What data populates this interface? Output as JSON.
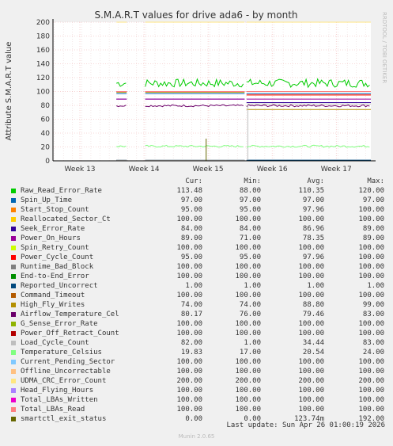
{
  "chart_data": {
    "type": "line",
    "title": "S.M.A.R.T values for drive ada6 - by month",
    "ylabel": "Attribute S.M.A.R.T value",
    "ylim": [
      0,
      200
    ],
    "yticks": [
      0,
      20,
      40,
      60,
      80,
      100,
      120,
      140,
      160,
      180,
      200
    ],
    "xticks": [
      "Week 13",
      "Week 14",
      "Week 15",
      "Week 16",
      "Week 17"
    ],
    "side_label": "RRDTOOL / TOBI OETIKER",
    "grid": true,
    "columns": [
      "Cur:",
      "Min:",
      "Avg:",
      "Max:"
    ],
    "series": [
      {
        "name": "Raw_Read_Error_Rate",
        "color": "#00cc00",
        "cur": "113.48",
        "min": "88.00",
        "avg": "110.35",
        "max": "120.00"
      },
      {
        "name": "Spin_Up_Time",
        "color": "#0066b3",
        "cur": "97.00",
        "min": "97.00",
        "avg": "97.00",
        "max": "97.00"
      },
      {
        "name": "Start_Stop_Count",
        "color": "#ff8000",
        "cur": "95.00",
        "min": "95.00",
        "avg": "97.96",
        "max": "100.00"
      },
      {
        "name": "Reallocated_Sector_Ct",
        "color": "#ffcc00",
        "cur": "100.00",
        "min": "100.00",
        "avg": "100.00",
        "max": "100.00"
      },
      {
        "name": "Seek_Error_Rate",
        "color": "#330099",
        "cur": "84.00",
        "min": "84.00",
        "avg": "86.96",
        "max": "89.00"
      },
      {
        "name": "Power_On_Hours",
        "color": "#990099",
        "cur": "89.00",
        "min": "71.00",
        "avg": "78.35",
        "max": "89.00"
      },
      {
        "name": "Spin_Retry_Count",
        "color": "#ccff00",
        "cur": "100.00",
        "min": "100.00",
        "avg": "100.00",
        "max": "100.00"
      },
      {
        "name": "Power_Cycle_Count",
        "color": "#ff0000",
        "cur": "95.00",
        "min": "95.00",
        "avg": "97.96",
        "max": "100.00"
      },
      {
        "name": "Runtime_Bad_Block",
        "color": "#808080",
        "cur": "100.00",
        "min": "100.00",
        "avg": "100.00",
        "max": "100.00"
      },
      {
        "name": "End-to-End_Error",
        "color": "#008f00",
        "cur": "100.00",
        "min": "100.00",
        "avg": "100.00",
        "max": "100.00"
      },
      {
        "name": "Reported_Uncorrect",
        "color": "#00487d",
        "cur": "1.00",
        "min": "1.00",
        "avg": "1.00",
        "max": "1.00"
      },
      {
        "name": "Command_Timeout",
        "color": "#b35a00",
        "cur": "100.00",
        "min": "100.00",
        "avg": "100.00",
        "max": "100.00"
      },
      {
        "name": "High_Fly_Writes",
        "color": "#b38f00",
        "cur": "74.00",
        "min": "74.00",
        "avg": "88.80",
        "max": "99.00"
      },
      {
        "name": "Airflow_Temperature_Cel",
        "color": "#6b006b",
        "cur": "80.17",
        "min": "76.00",
        "avg": "79.46",
        "max": "83.00"
      },
      {
        "name": "G_Sense_Error_Rate",
        "color": "#8fb300",
        "cur": "100.00",
        "min": "100.00",
        "avg": "100.00",
        "max": "100.00"
      },
      {
        "name": "Power_Off_Retract_Count",
        "color": "#b30000",
        "cur": "100.00",
        "min": "100.00",
        "avg": "100.00",
        "max": "100.00"
      },
      {
        "name": "Load_Cycle_Count",
        "color": "#bebebe",
        "cur": "82.00",
        "min": "1.00",
        "avg": "34.44",
        "max": "83.00"
      },
      {
        "name": "Temperature_Celsius",
        "color": "#80ff80",
        "cur": "19.83",
        "min": "17.00",
        "avg": "20.54",
        "max": "24.00"
      },
      {
        "name": "Current_Pending_Sector",
        "color": "#80c9ff",
        "cur": "100.00",
        "min": "100.00",
        "avg": "100.00",
        "max": "100.00"
      },
      {
        "name": "Offline_Uncorrectable",
        "color": "#ffc080",
        "cur": "100.00",
        "min": "100.00",
        "avg": "100.00",
        "max": "100.00"
      },
      {
        "name": "UDMA_CRC_Error_Count",
        "color": "#ffe680",
        "cur": "200.00",
        "min": "200.00",
        "avg": "200.00",
        "max": "200.00"
      },
      {
        "name": "Head_Flying_Hours",
        "color": "#aa80ff",
        "cur": "100.00",
        "min": "100.00",
        "avg": "100.00",
        "max": "100.00"
      },
      {
        "name": "Total_LBAs_Written",
        "color": "#ee00cc",
        "cur": "100.00",
        "min": "100.00",
        "avg": "100.00",
        "max": "100.00"
      },
      {
        "name": "Total_LBAs_Read",
        "color": "#ff8080",
        "cur": "100.00",
        "min": "100.00",
        "avg": "100.00",
        "max": "100.00"
      },
      {
        "name": "smartctl_exit_status",
        "color": "#666600",
        "cur": "0.00",
        "min": "0.00",
        "avg": "123.74m",
        "max": "192.00"
      }
    ]
  },
  "footer": {
    "last_update": "Last update: Sun Apr 26 01:00:19 2026",
    "version": "Munin 2.0.65"
  }
}
